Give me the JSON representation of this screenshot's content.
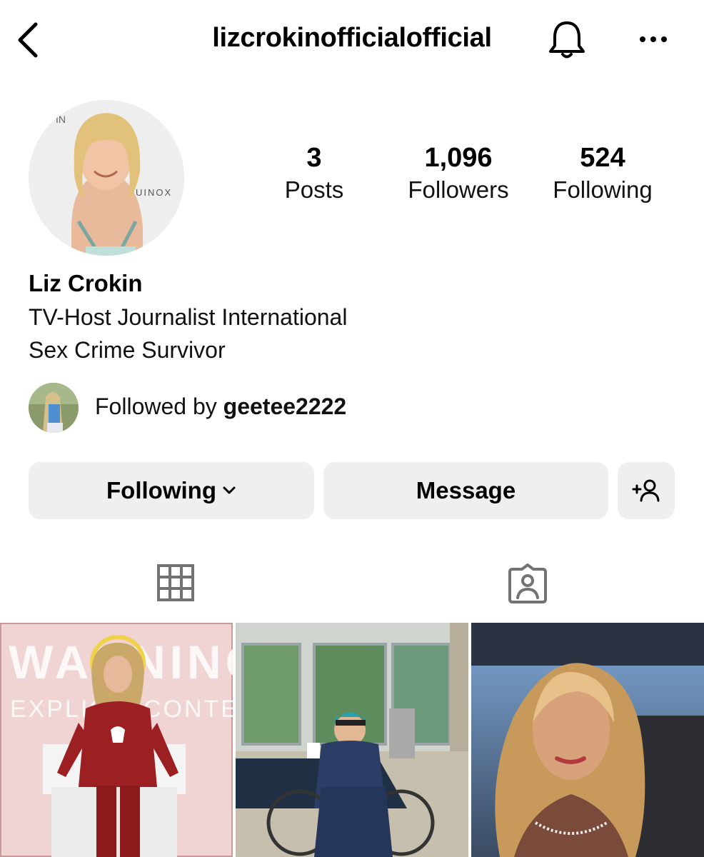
{
  "header": {
    "username": "lizcrokinofficialofficial",
    "back_icon": "chevron-left-icon",
    "bell_icon": "bell-icon",
    "more_icon": "more-horizontal-icon"
  },
  "profile": {
    "avatar_sign_text_1": "IN",
    "avatar_sign_text_2": "UINOX",
    "stats": [
      {
        "value": "3",
        "label": "Posts"
      },
      {
        "value": "1,096",
        "label": "Followers"
      },
      {
        "value": "524",
        "label": "Following"
      }
    ],
    "name": "Liz Crokin",
    "bio_lines": [
      "TV-Host Journalist International",
      "Sex Crime Survivor"
    ],
    "followed_by_prefix": "Followed by ",
    "followed_by_user": "geetee2222"
  },
  "actions": {
    "following_label": "Following",
    "message_label": "Message",
    "add_user_icon": "add-user-icon"
  },
  "tabs": {
    "grid_icon": "grid-icon",
    "tagged_icon": "tagged-person-icon"
  },
  "posts": [
    {
      "overlay_top": "WARNING",
      "overlay_bottom": "EXPLICIT CONTENT"
    },
    {
      "overlay_top": "",
      "overlay_bottom": ""
    },
    {
      "overlay_top": "",
      "overlay_bottom": ""
    }
  ],
  "colors": {
    "button_bg": "#efefef",
    "text": "#000000",
    "icon": "#262626"
  }
}
